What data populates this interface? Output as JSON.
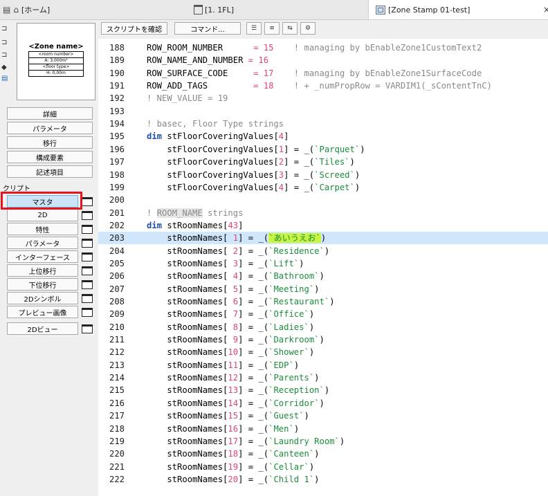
{
  "tabs": {
    "home": "[ホーム]",
    "floor": "[1. 1FL]",
    "zone": "[Zone Stamp 01-test]",
    "close": "×"
  },
  "preview": {
    "zone_name": "<Zone name>",
    "rows": [
      "<room number>",
      "A: 3,000m²",
      "<floor type>",
      "H: 0,00m"
    ]
  },
  "left_buttons": [
    "詳細",
    "パラメータ",
    "移行",
    "構成要素",
    "記述項目"
  ],
  "script_section_label": "クリプト",
  "script_buttons": [
    {
      "label": "マスタ",
      "active": true
    },
    {
      "label": "2D"
    },
    {
      "label": "特性"
    },
    {
      "label": "パラメータ"
    },
    {
      "label": "インターフェース"
    },
    {
      "label": "上位移行"
    },
    {
      "label": "下位移行"
    },
    {
      "label": "2Dシンボル"
    },
    {
      "label": "プレビュー画像"
    },
    {
      "label": "2Dビュー"
    }
  ],
  "toolbar": {
    "check_script": "スクリプトを確認",
    "commands": "コマンド...",
    "icon_buttons": [
      "list-icon",
      "list-numbered-icon",
      "code-icon",
      "gear-icon"
    ]
  },
  "code_lines": [
    {
      "n": "188",
      "tokens": [
        [
          "",
          "ROW_ROOM_NUMBER      "
        ],
        [
          "num",
          "= 15"
        ],
        [
          "cmt",
          "    ! managing by bEnableZone1CustomText2"
        ]
      ]
    },
    {
      "n": "189",
      "tokens": [
        [
          "",
          "ROW_NAME_AND_NUMBER "
        ],
        [
          "num",
          "= 16"
        ]
      ]
    },
    {
      "n": "190",
      "tokens": [
        [
          "",
          "ROW_SURFACE_CODE     "
        ],
        [
          "num",
          "= 17"
        ],
        [
          "cmt",
          "    ! managing by bEnableZone1SurfaceCode"
        ]
      ]
    },
    {
      "n": "191",
      "tokens": [
        [
          "",
          "ROW_ADD_TAGS         "
        ],
        [
          "num",
          "= 18"
        ],
        [
          "cmt",
          "    ! + _numPropRow = VARDIM1(_sContentTnC)"
        ]
      ]
    },
    {
      "n": "192",
      "tokens": [
        [
          "cmt",
          "! NEW_VALUE = 19"
        ]
      ]
    },
    {
      "n": "193",
      "tokens": []
    },
    {
      "n": "194",
      "tokens": [
        [
          "cmt",
          "! basec, Floor Type strings"
        ]
      ]
    },
    {
      "n": "195",
      "tokens": [
        [
          "kw",
          "dim"
        ],
        [
          "",
          " stFloorCoveringValues["
        ],
        [
          "num",
          "4"
        ],
        [
          "",
          "]"
        ]
      ]
    },
    {
      "n": "196",
      "tokens": [
        [
          "",
          "    stFloorCoveringValues["
        ],
        [
          "num",
          "1"
        ],
        [
          "",
          "] = _("
        ],
        [
          "str",
          "`Parquet`"
        ],
        [
          "",
          ")"
        ]
      ]
    },
    {
      "n": "197",
      "tokens": [
        [
          "",
          "    stFloorCoveringValues["
        ],
        [
          "num",
          "2"
        ],
        [
          "",
          "] = _("
        ],
        [
          "str",
          "`Tiles`"
        ],
        [
          "",
          ")"
        ]
      ]
    },
    {
      "n": "198",
      "tokens": [
        [
          "",
          "    stFloorCoveringValues["
        ],
        [
          "num",
          "3"
        ],
        [
          "",
          "] = _("
        ],
        [
          "str",
          "`Screed`"
        ],
        [
          "",
          ")"
        ]
      ]
    },
    {
      "n": "199",
      "tokens": [
        [
          "",
          "    stFloorCoveringValues["
        ],
        [
          "num",
          "4"
        ],
        [
          "",
          "] = _("
        ],
        [
          "str",
          "`Carpet`"
        ],
        [
          "",
          ")"
        ]
      ]
    },
    {
      "n": "200",
      "tokens": []
    },
    {
      "n": "201",
      "tokens": [
        [
          "cmt",
          "! "
        ],
        [
          "hlw",
          "ROOM_NAME"
        ],
        [
          "cmt",
          " strings"
        ]
      ]
    },
    {
      "n": "202",
      "tokens": [
        [
          "kw",
          "dim"
        ],
        [
          "",
          " stRoomNames["
        ],
        [
          "num",
          "43"
        ],
        [
          "",
          "]"
        ]
      ]
    },
    {
      "n": "203",
      "current": true,
      "tokens": [
        [
          "",
          "    stRoomNames[ "
        ],
        [
          "num",
          "1"
        ],
        [
          "",
          "] = _("
        ],
        [
          "hlstr",
          "`あいうえお`"
        ],
        [
          "",
          ")"
        ]
      ]
    },
    {
      "n": "204",
      "tokens": [
        [
          "",
          "    stRoomNames[ "
        ],
        [
          "num",
          "2"
        ],
        [
          "",
          "] = _("
        ],
        [
          "str",
          "`Residence`"
        ],
        [
          "",
          ")"
        ]
      ]
    },
    {
      "n": "205",
      "tokens": [
        [
          "",
          "    stRoomNames[ "
        ],
        [
          "num",
          "3"
        ],
        [
          "",
          "] = _("
        ],
        [
          "str",
          "`Lift`"
        ],
        [
          "",
          ")"
        ]
      ]
    },
    {
      "n": "206",
      "tokens": [
        [
          "",
          "    stRoomNames[ "
        ],
        [
          "num",
          "4"
        ],
        [
          "",
          "] = _("
        ],
        [
          "str",
          "`Bathroom`"
        ],
        [
          "",
          ")"
        ]
      ]
    },
    {
      "n": "207",
      "tokens": [
        [
          "",
          "    stRoomNames[ "
        ],
        [
          "num",
          "5"
        ],
        [
          "",
          "] = _("
        ],
        [
          "str",
          "`Meeting`"
        ],
        [
          "",
          ")"
        ]
      ]
    },
    {
      "n": "208",
      "tokens": [
        [
          "",
          "    stRoomNames[ "
        ],
        [
          "num",
          "6"
        ],
        [
          "",
          "] = _("
        ],
        [
          "str",
          "`Restaurant`"
        ],
        [
          "",
          ")"
        ]
      ]
    },
    {
      "n": "209",
      "tokens": [
        [
          "",
          "    stRoomNames[ "
        ],
        [
          "num",
          "7"
        ],
        [
          "",
          "] = _("
        ],
        [
          "str",
          "`Office`"
        ],
        [
          "",
          ")"
        ]
      ]
    },
    {
      "n": "210",
      "tokens": [
        [
          "",
          "    stRoomNames[ "
        ],
        [
          "num",
          "8"
        ],
        [
          "",
          "] = _("
        ],
        [
          "str",
          "`Ladies`"
        ],
        [
          "",
          ")"
        ]
      ]
    },
    {
      "n": "211",
      "tokens": [
        [
          "",
          "    stRoomNames[ "
        ],
        [
          "num",
          "9"
        ],
        [
          "",
          "] = _("
        ],
        [
          "str",
          "`Darkroom`"
        ],
        [
          "",
          ")"
        ]
      ]
    },
    {
      "n": "212",
      "tokens": [
        [
          "",
          "    stRoomNames["
        ],
        [
          "num",
          "10"
        ],
        [
          "",
          "] = _("
        ],
        [
          "str",
          "`Shower`"
        ],
        [
          "",
          ")"
        ]
      ]
    },
    {
      "n": "213",
      "tokens": [
        [
          "",
          "    stRoomNames["
        ],
        [
          "num",
          "11"
        ],
        [
          "",
          "] = _("
        ],
        [
          "str",
          "`EDP`"
        ],
        [
          "",
          ")"
        ]
      ]
    },
    {
      "n": "214",
      "tokens": [
        [
          "",
          "    stRoomNames["
        ],
        [
          "num",
          "12"
        ],
        [
          "",
          "] = _("
        ],
        [
          "str",
          "`Parents`"
        ],
        [
          "",
          ")"
        ]
      ]
    },
    {
      "n": "215",
      "tokens": [
        [
          "",
          "    stRoomNames["
        ],
        [
          "num",
          "13"
        ],
        [
          "",
          "] = _("
        ],
        [
          "str",
          "`Reception`"
        ],
        [
          "",
          ")"
        ]
      ]
    },
    {
      "n": "216",
      "tokens": [
        [
          "",
          "    stRoomNames["
        ],
        [
          "num",
          "14"
        ],
        [
          "",
          "] = _("
        ],
        [
          "str",
          "`Corridor`"
        ],
        [
          "",
          ")"
        ]
      ]
    },
    {
      "n": "217",
      "tokens": [
        [
          "",
          "    stRoomNames["
        ],
        [
          "num",
          "15"
        ],
        [
          "",
          "] = _("
        ],
        [
          "str",
          "`Guest`"
        ],
        [
          "",
          ")"
        ]
      ]
    },
    {
      "n": "218",
      "tokens": [
        [
          "",
          "    stRoomNames["
        ],
        [
          "num",
          "16"
        ],
        [
          "",
          "] = _("
        ],
        [
          "str",
          "`Men`"
        ],
        [
          "",
          ")"
        ]
      ]
    },
    {
      "n": "219",
      "tokens": [
        [
          "",
          "    stRoomNames["
        ],
        [
          "num",
          "17"
        ],
        [
          "",
          "] = _("
        ],
        [
          "str",
          "`Laundry Room`"
        ],
        [
          "",
          ")"
        ]
      ]
    },
    {
      "n": "220",
      "tokens": [
        [
          "",
          "    stRoomNames["
        ],
        [
          "num",
          "18"
        ],
        [
          "",
          "] = _("
        ],
        [
          "str",
          "`Canteen`"
        ],
        [
          "",
          ")"
        ]
      ]
    },
    {
      "n": "221",
      "tokens": [
        [
          "",
          "    stRoomNames["
        ],
        [
          "num",
          "19"
        ],
        [
          "",
          "] = _("
        ],
        [
          "str",
          "`Cellar`"
        ],
        [
          "",
          ")"
        ]
      ]
    },
    {
      "n": "222",
      "tokens": [
        [
          "",
          "    stRoomNames["
        ],
        [
          "num",
          "20"
        ],
        [
          "",
          "] = _("
        ],
        [
          "str",
          "`Child 1`"
        ],
        [
          "",
          ")"
        ]
      ]
    }
  ]
}
